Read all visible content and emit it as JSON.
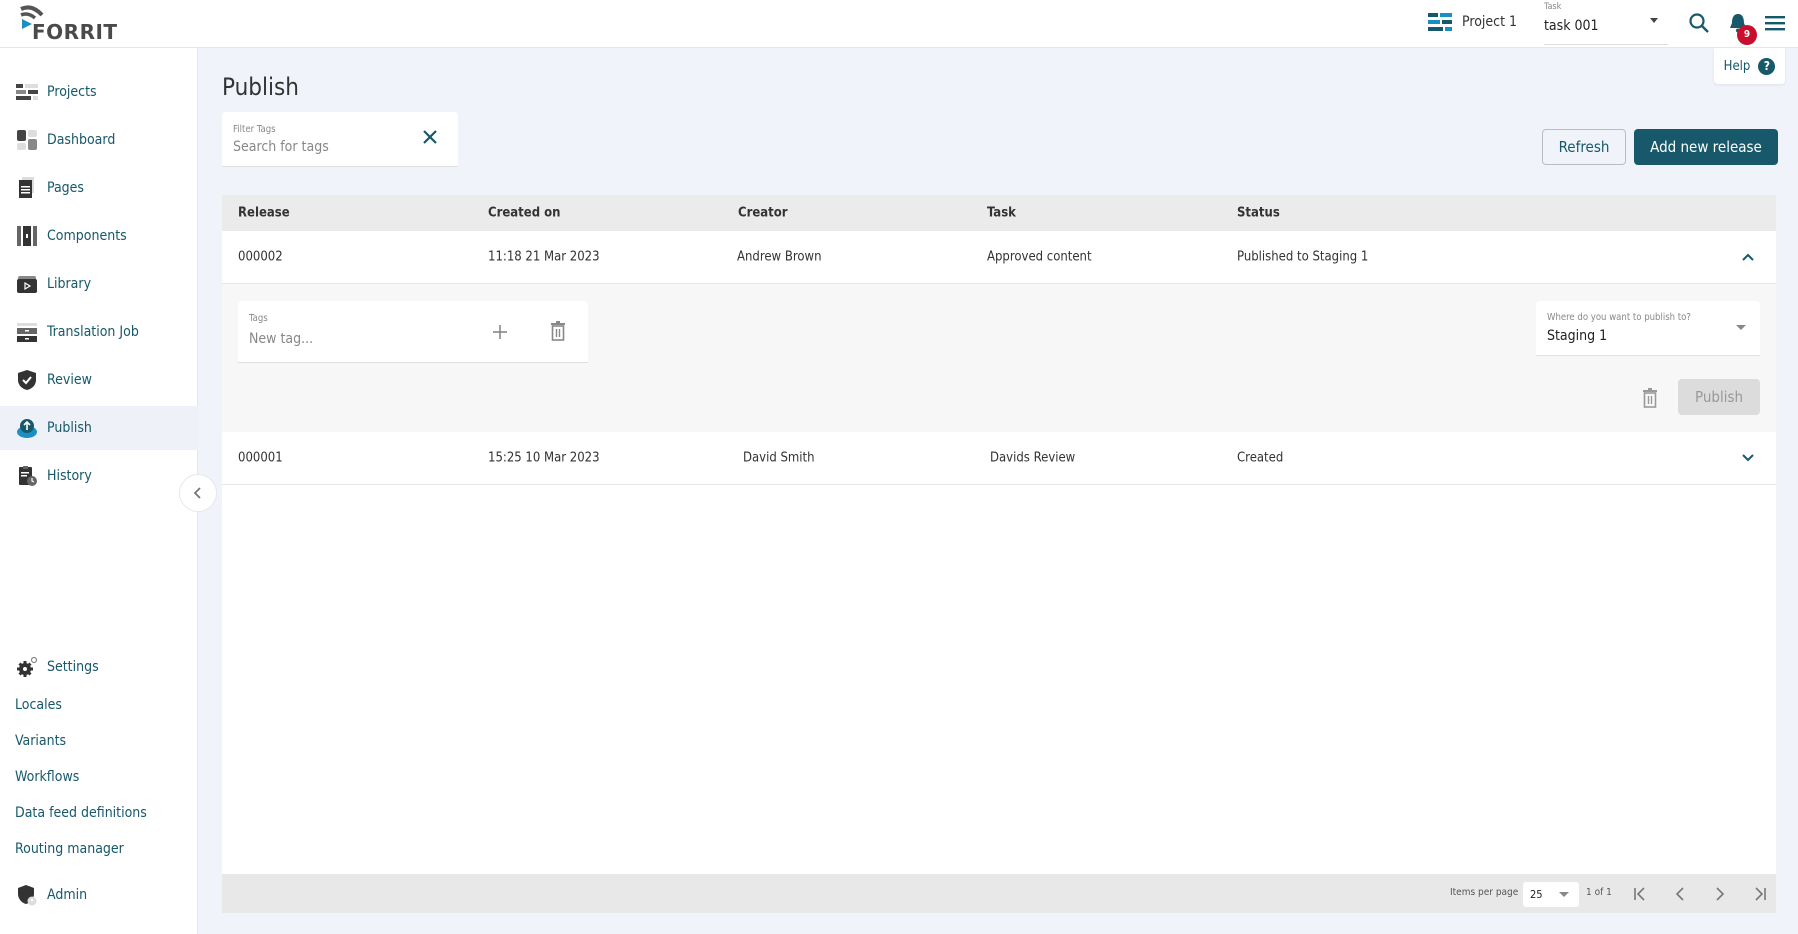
{
  "header": {
    "logo_text": "FORRIT",
    "project_label": "Project 1",
    "task_select": {
      "label": "Task",
      "value": "task 001"
    },
    "notification_count": "9",
    "help_label": "Help",
    "help_icon_text": "?"
  },
  "sidebar": {
    "items": [
      {
        "label": "Projects",
        "icon": "projects-icon"
      },
      {
        "label": "Dashboard",
        "icon": "dashboard-icon"
      },
      {
        "label": "Pages",
        "icon": "pages-icon"
      },
      {
        "label": "Components",
        "icon": "components-icon"
      },
      {
        "label": "Library",
        "icon": "library-icon"
      },
      {
        "label": "Translation Job",
        "icon": "translation-job-icon"
      },
      {
        "label": "Review",
        "icon": "review-icon"
      },
      {
        "label": "Publish",
        "icon": "publish-icon",
        "active": true
      },
      {
        "label": "History",
        "icon": "history-icon"
      }
    ],
    "settings_label": "Settings",
    "settings_links": [
      "Locales",
      "Variants",
      "Workflows",
      "Data feed definitions",
      "Routing manager"
    ],
    "admin_label": "Admin",
    "collapse_glyph": "‹"
  },
  "main": {
    "title": "Publish",
    "filter": {
      "label": "Filter Tags",
      "placeholder": "Search for tags"
    },
    "refresh_label": "Refresh",
    "add_label": "Add new release",
    "table": {
      "columns": [
        "Release",
        "Created on",
        "Creator",
        "Task",
        "Status"
      ],
      "rows": [
        {
          "release": "000002",
          "created_on": "11:18 21 Mar 2023",
          "creator": "Andrew Brown",
          "task": "Approved content",
          "status": "Published to Staging 1",
          "expanded": true
        },
        {
          "release": "000001",
          "created_on": "15:25 10 Mar 2023",
          "creator": "David Smith",
          "task": "Davids Review",
          "status": "Created",
          "expanded": false
        }
      ],
      "expanded_panel": {
        "tags_label": "Tags",
        "tags_placeholder": "New tag...",
        "destination_label": "Where do you want to publish to?",
        "destination_value": "Staging 1",
        "publish_label": "Publish"
      }
    },
    "pagination": {
      "items_per_page_label": "Items per page",
      "items_per_page": "25",
      "page_info": "1 of 1"
    }
  },
  "colors": {
    "accent": "#17586a",
    "badge": "#c8102e",
    "publish_icon": "#1a8fc4"
  }
}
